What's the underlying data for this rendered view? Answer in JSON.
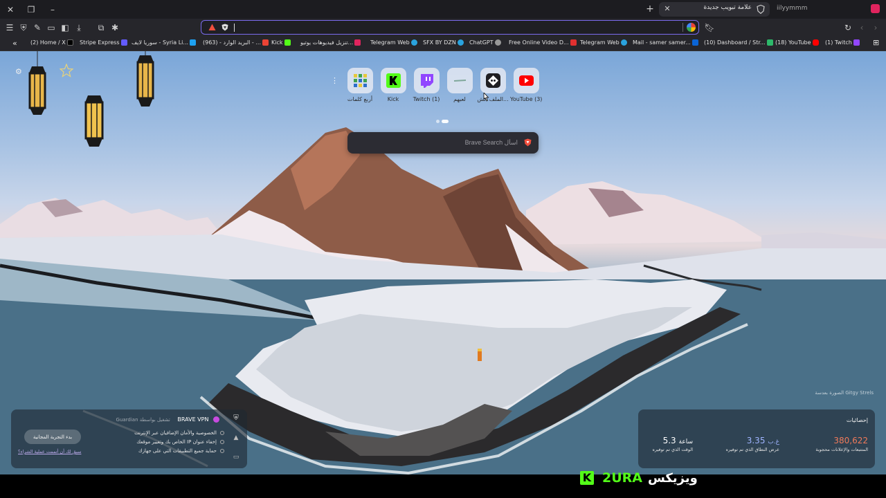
{
  "titlebar": {
    "tab_title": "علامة تبويب جديدة",
    "profile_name": "iilyymmm"
  },
  "toolbar": {
    "url_value": ""
  },
  "bookmarks": [
    {
      "label": "(2) Home / X",
      "icon": "x-icon",
      "color": "#000000"
    },
    {
      "label": "Stripe Express",
      "icon": "stripe-icon",
      "color": "#635bff"
    },
    {
      "label": "سوريا لايف - Syria Li...",
      "icon": "syria-live-icon",
      "color": "#1da1f2"
    },
    {
      "label": "(963) - البريد الوارد - ...",
      "icon": "gmail-icon",
      "color": "#ea4335"
    },
    {
      "label": "Kick",
      "icon": "kick-icon",
      "color": "#53fc18"
    },
    {
      "label": "تنزيل فيديوهات يوتيو...",
      "icon": "download-icon",
      "color": "#e0245e"
    },
    {
      "label": "Telegram Web",
      "icon": "telegram-icon",
      "color": "#2aa3de"
    },
    {
      "label": "SFX BY DZN",
      "icon": "sfx-icon",
      "color": "#2aa3de"
    },
    {
      "label": "ChatGPT",
      "icon": "chatgpt-icon",
      "color": "#aaaaaa"
    },
    {
      "label": "Free Online Video D...",
      "icon": "video-download-icon",
      "color": "#e03030"
    },
    {
      "label": "Telegram Web",
      "icon": "telegram-icon",
      "color": "#2aa3de"
    },
    {
      "label": "Mail - samer samer...",
      "icon": "outlook-icon",
      "color": "#0a64d6"
    },
    {
      "label": "(10) Dashboard / Str...",
      "icon": "dashboard-icon",
      "color": "#2db86a"
    },
    {
      "label": "(18) YouTube",
      "icon": "youtube-icon",
      "color": "#ff0000"
    },
    {
      "label": "(1) Twitch",
      "icon": "twitch-icon",
      "color": "#9146ff"
    }
  ],
  "tiles": [
    {
      "label": "أربع كلمات",
      "icon": "four-words-icon"
    },
    {
      "label": "Kick",
      "icon": "kick-icon"
    },
    {
      "label": "Twitch (1)",
      "icon": "twitch-icon"
    },
    {
      "label": "لعبهم",
      "icon": "game-icon"
    },
    {
      "label": "الملف الش...",
      "icon": "discord-icon"
    },
    {
      "label": "YouTube (3)",
      "icon": "youtube-icon"
    }
  ],
  "search": {
    "placeholder": "اسأل Brave Search"
  },
  "credit": "الصورة بعدسة Gitgy Strels",
  "vpn": {
    "title": "BRAVE VPN",
    "powered_by": "تشغيل بواسطة",
    "partner": "Guardian",
    "features": [
      "الخصوصية والأمان الإضافيان عبر الإنترنت",
      "إخفاء عنوان IP الخاص بك وتغيير موقعك",
      "حماية جميع التطبيقات التي على جهازك"
    ],
    "cta": "بدء التجربة المجانية",
    "link": "سبق لك أن أتممت عملية الشراء؟"
  },
  "stats": {
    "title": "إحصائيات",
    "items": [
      {
        "value": "380,622",
        "unit": "",
        "label": "المتتبعات والإعلانات محجوبة",
        "color": "#f07a5a"
      },
      {
        "value": "3.35",
        "unit": "غ.ب",
        "label": "عرض النطاق الذي تم توفيره",
        "color": "#9fb4ff"
      },
      {
        "value": "5.3",
        "unit": "ساعة",
        "label": "الوقت الذي تم توفيره",
        "color": "#ffffff"
      }
    ]
  },
  "watermark": {
    "k_letter": "K",
    "green_text": "2URA",
    "white_text": "ويزيكس"
  }
}
